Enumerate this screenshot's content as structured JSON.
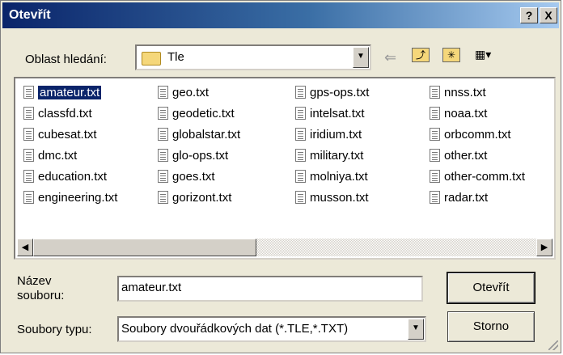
{
  "window": {
    "title": "Otevřít",
    "help_label": "?",
    "close_label": "X"
  },
  "lookin": {
    "label": "Oblast hledání:",
    "value": "Tle"
  },
  "toolbar": {
    "back_icon": "back-arrow-icon",
    "up_icon": "folder-up-icon",
    "new_folder_icon": "new-folder-icon",
    "view_icon": "view-menu-icon"
  },
  "files": [
    [
      "amateur.txt",
      "classfd.txt",
      "cubesat.txt",
      "dmc.txt",
      "education.txt",
      "engineering.txt"
    ],
    [
      "geo.txt",
      "geodetic.txt",
      "globalstar.txt",
      "glo-ops.txt",
      "goes.txt",
      "gorizont.txt"
    ],
    [
      "gps-ops.txt",
      "intelsat.txt",
      "iridium.txt",
      "military.txt",
      "molniya.txt",
      "musson.txt"
    ],
    [
      "nnss.txt",
      "noaa.txt",
      "orbcomm.txt",
      "other.txt",
      "other-comm.txt",
      "radar.txt"
    ]
  ],
  "selected_file": "amateur.txt",
  "filename": {
    "label_line1": "Název",
    "label_line2": "souboru:",
    "value": "amateur.txt"
  },
  "filetype": {
    "label": "Soubory typu:",
    "value": "Soubory dvouřádkových dat (*.TLE,*.TXT)"
  },
  "buttons": {
    "open": "Otevřít",
    "cancel": "Storno"
  }
}
